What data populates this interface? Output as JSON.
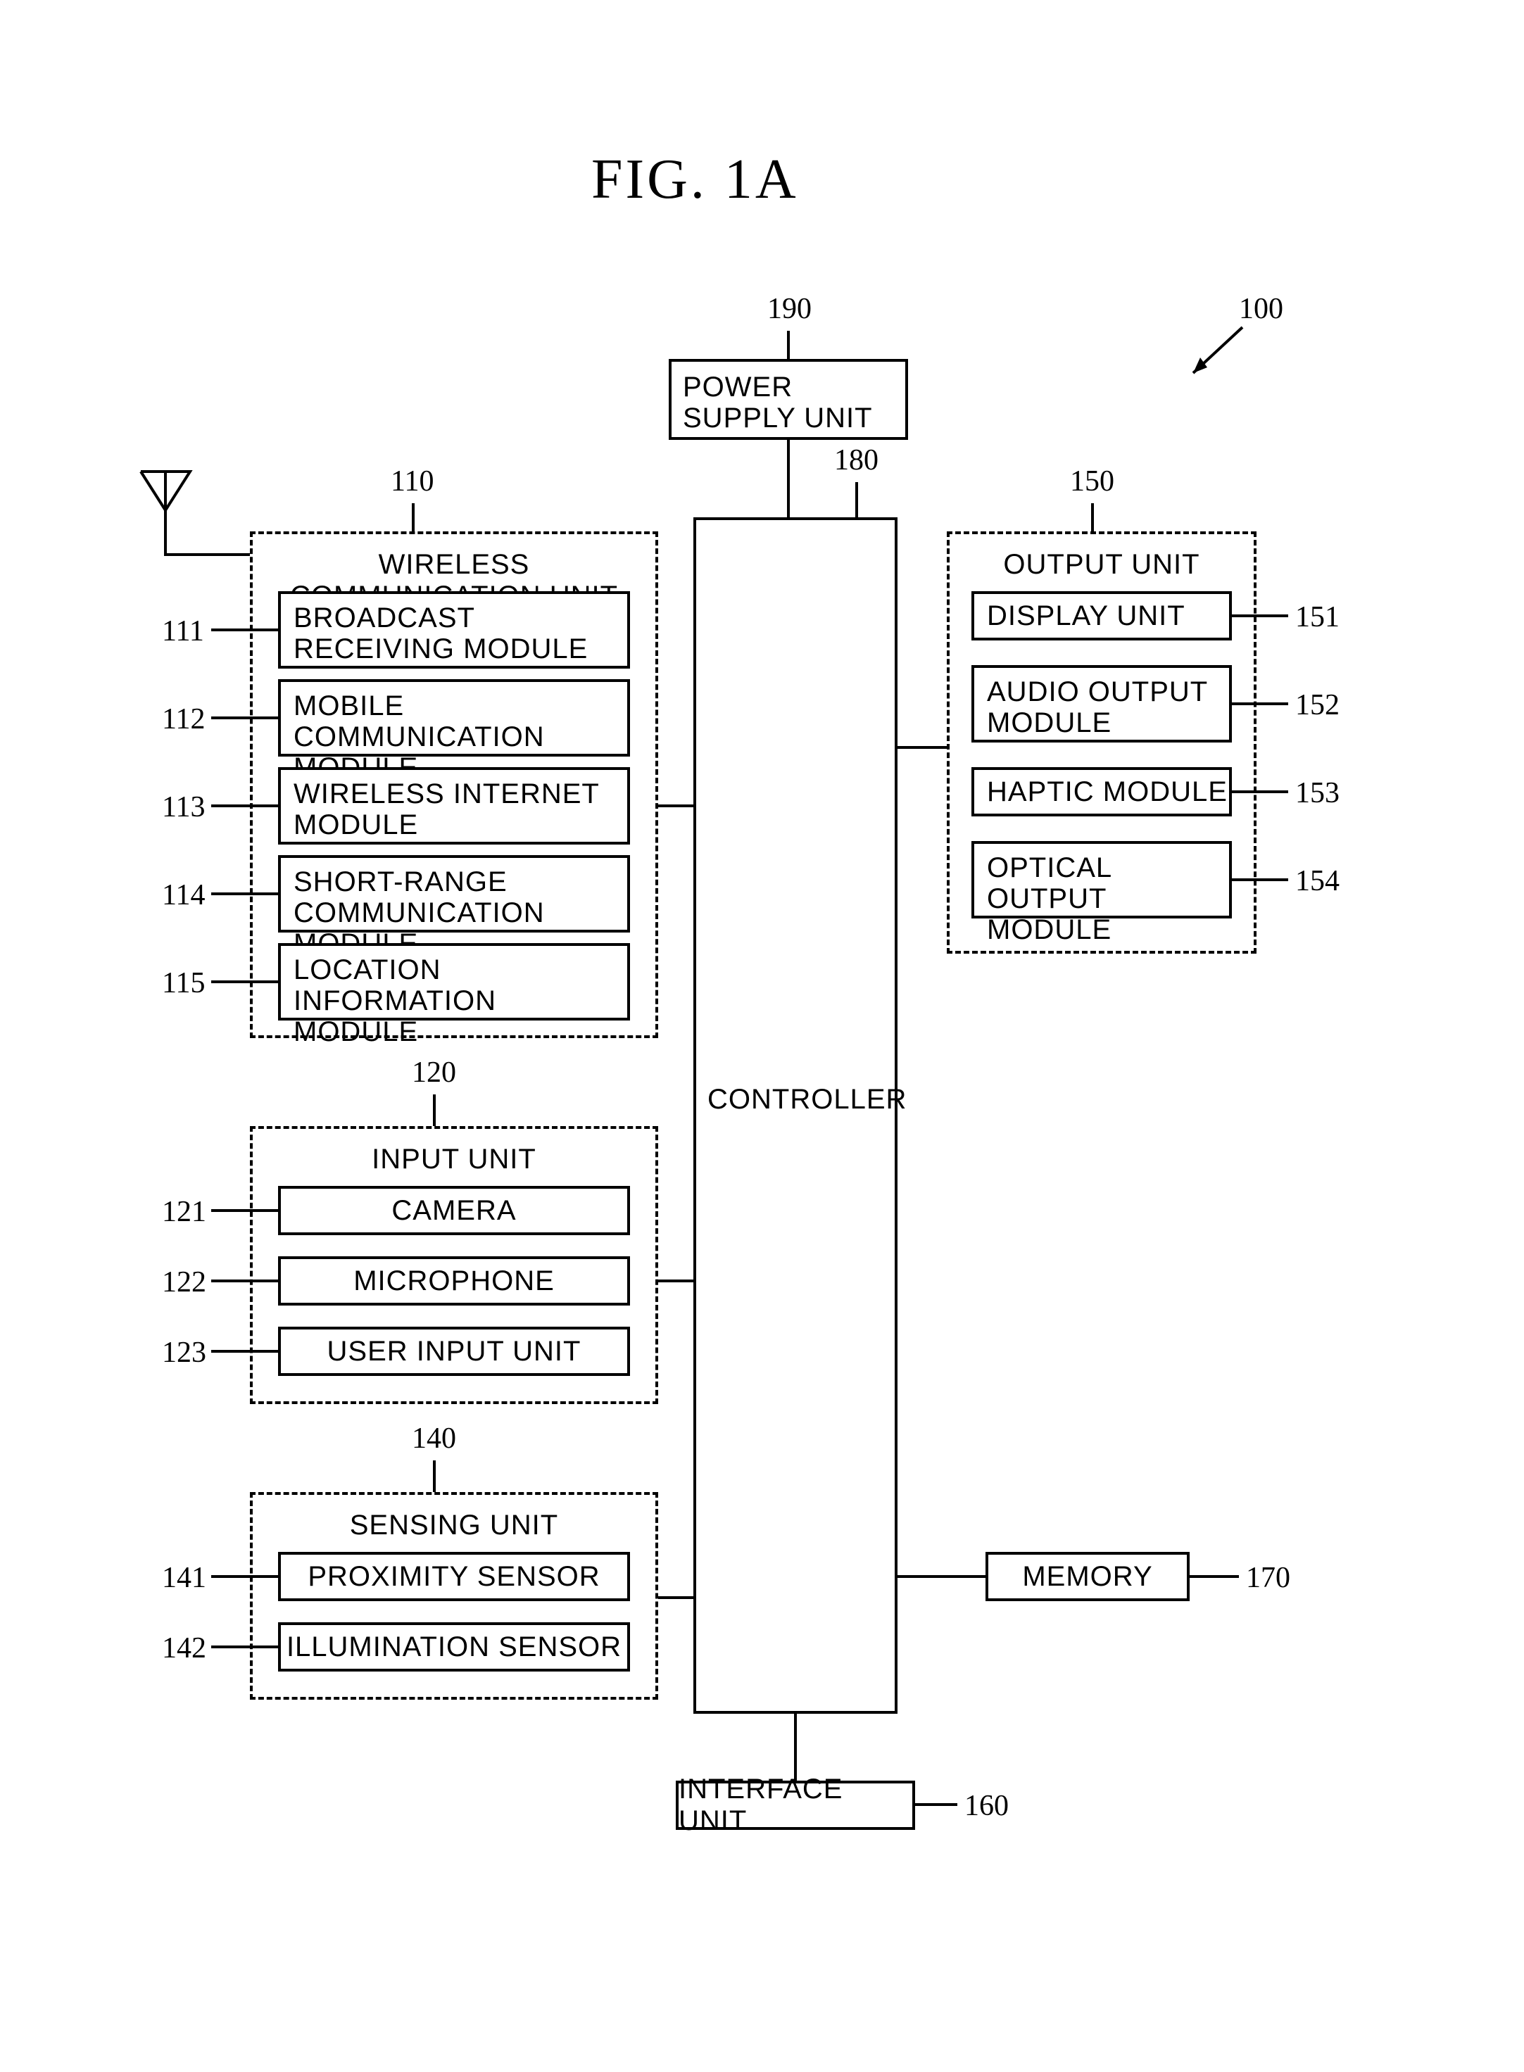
{
  "figure": {
    "title": "FIG.  1A"
  },
  "refs": {
    "r100": "100",
    "r110": "110",
    "r111": "111",
    "r112": "112",
    "r113": "113",
    "r114": "114",
    "r115": "115",
    "r120": "120",
    "r121": "121",
    "r122": "122",
    "r123": "123",
    "r140": "140",
    "r141": "141",
    "r142": "142",
    "r150": "150",
    "r151": "151",
    "r152": "152",
    "r153": "153",
    "r154": "154",
    "r160": "160",
    "r170": "170",
    "r180": "180",
    "r190": "190"
  },
  "blocks": {
    "power": "POWER SUPPLY UNIT",
    "controller": "CONTROLLER",
    "wireless_title": "WIRELESS COMMUNICATION UNIT",
    "broadcast": "BROADCAST RECEIVING MODULE",
    "mobile": "MOBILE COMMUNICATION MODULE",
    "winternet": "WIRELESS INTERNET MODULE",
    "shortrange": "SHORT-RANGE COMMUNICATION MODULE",
    "location": "LOCATION INFORMATION MODULE",
    "input_title": "INPUT UNIT",
    "camera": "CAMERA",
    "microphone": "MICROPHONE",
    "userinput": "USER INPUT UNIT",
    "sensing_title": "SENSING UNIT",
    "proximity": "PROXIMITY SENSOR",
    "illumination": "ILLUMINATION SENSOR",
    "output_title": "OUTPUT UNIT",
    "display": "DISPLAY UNIT",
    "audio": "AUDIO OUTPUT MODULE",
    "haptic": "HAPTIC MODULE",
    "optical": "OPTICAL OUTPUT MODULE",
    "memory": "MEMORY",
    "interface": "INTERFACE UNIT"
  }
}
